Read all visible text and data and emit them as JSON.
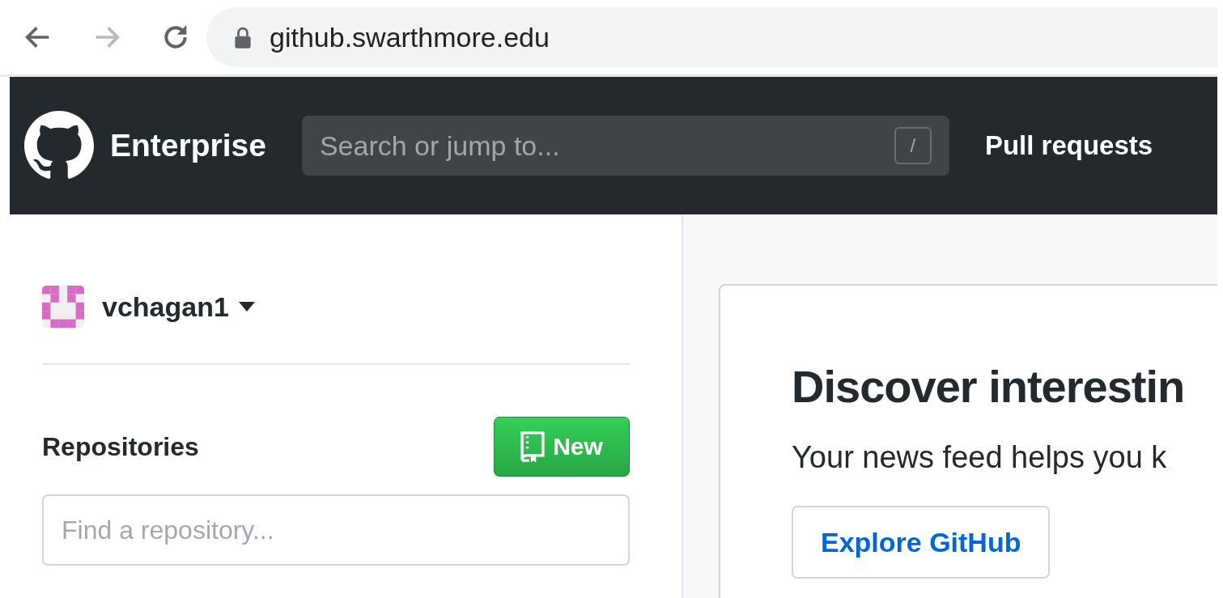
{
  "browser": {
    "url": "github.swarthmore.edu",
    "back_disabled": false,
    "forward_disabled": true
  },
  "header": {
    "brand": "Enterprise",
    "search": {
      "placeholder": "Search or jump to...",
      "shortcut": "/"
    },
    "nav": [
      "Pull requests"
    ]
  },
  "sidebar": {
    "user": "vchagan1",
    "repositories_title": "Repositories",
    "new_button": "New",
    "filter": {
      "placeholder": "Find a repository..."
    }
  },
  "main": {
    "title": "Discover interestin",
    "text": "Your news feed helps you k",
    "button": "Explore GitHub"
  }
}
